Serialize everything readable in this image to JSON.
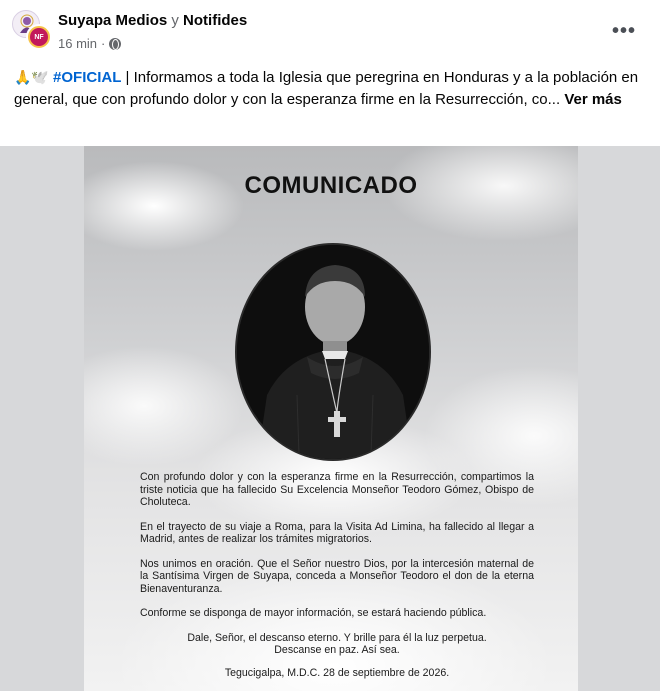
{
  "header": {
    "page_name": "Suyapa Medios",
    "conjunction": "y",
    "coauthor_name": "Notifides",
    "time": "16 min",
    "separator": "·",
    "privacy_icon": "globe-icon",
    "more_icon": "more-options-icon",
    "more_label": "•••",
    "coauthor_avatar_text": "NF"
  },
  "post": {
    "emoji": "🙏🕊️",
    "hashtag": "#OFICIAL",
    "text": " | Informamos a toda la Iglesia que peregrina en Honduras y a la población en general, que con profundo dolor y con la esperanza firme en la Resurrección, co... ",
    "see_more": "Ver más"
  },
  "notice": {
    "title": "COMUNICADO",
    "paragraphs": [
      "Con profundo dolor y con la esperanza firme en la Resurrección, compartimos la triste noticia que ha fallecido Su Excelencia Monseñor Teodoro Gómez, Obispo de Choluteca.",
      "En el trayecto de su viaje a Roma, para la Visita Ad Limina, ha fallecido al llegar a Madrid, antes de realizar los trámites migratorios.",
      "Nos unimos en oración. Que el Señor nuestro Dios, por la intercesión maternal de la Santísima Virgen de Suyapa, conceda a Monseñor Teodoro el don de la eterna Bienaventuranza.",
      "Conforme se disponga de mayor información, se estará haciendo pública."
    ],
    "prayer_line1": "Dale, Señor, el descanso eterno. Y brille para él la luz perpetua.",
    "prayer_line2": "Descanse en paz. Así sea.",
    "place_date": "Tegucigalpa, M.D.C. 28 de septiembre de 2026."
  },
  "colors": {
    "link": "#0064d1",
    "secondary_text": "#65676b",
    "image_letterbox": "#d7d8da"
  }
}
